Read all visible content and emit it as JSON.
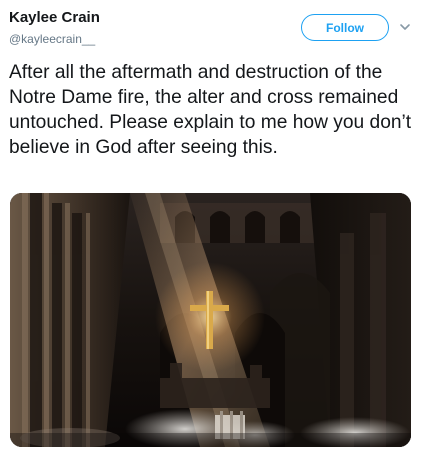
{
  "tweet": {
    "author": {
      "display_name": "Kaylee Crain",
      "username": "@kayleecrain__"
    },
    "follow_label": "Follow",
    "text": "After all the aftermath and destruction of the Notre Dame fire, the alter and cross remained untouched. Please explain to me how you don’t believe in God after seeing this.",
    "media": {
      "icon": "cathedral-interior-photo"
    }
  },
  "colors": {
    "accent": "#1da1f2",
    "text": "#14171a",
    "secondary_text": "#657786"
  }
}
